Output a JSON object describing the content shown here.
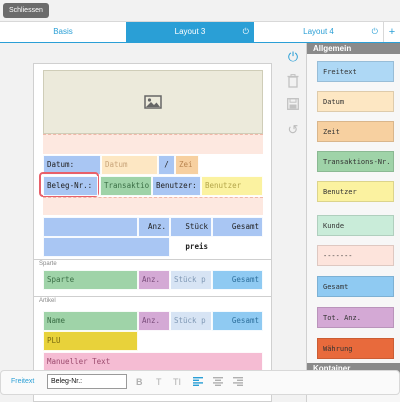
{
  "topbar": {
    "close_label": "Schliessen"
  },
  "tabs": [
    {
      "label": "Basis"
    },
    {
      "label": "Layout 3"
    },
    {
      "label": "Layout 4"
    }
  ],
  "tab_power_icon": "⏻",
  "add_tab_icon": "+",
  "canvas": {
    "image_icon": "image-icon",
    "header_rows": {
      "datum_label": "Datum:",
      "datum_value": "Datum",
      "slash": "/",
      "zeit_value": "Zei",
      "beleg_label": "Beleg-Nr.:",
      "transaktion_value": "Transaktio",
      "benutzer_label": "Benutzer:",
      "benutzer_value": "Benutzer"
    },
    "column_headers": {
      "anz": "Anz.",
      "stueck": "Stück",
      "gesamt": "Gesamt",
      "preis": "preis"
    },
    "sparte_section": {
      "title": "Sparte",
      "cells": [
        "Sparte",
        "Anz.",
        "Stück p",
        "Gesamt"
      ]
    },
    "artikel_section": {
      "title": "Artikel",
      "name_row": [
        "Name",
        "Anz.",
        "Stück p",
        "Gesamt"
      ],
      "plu": "PLU",
      "manueller_text": "Manueller Text"
    }
  },
  "tools": {
    "power": "⏻",
    "delete": "🗑",
    "save": "💾",
    "undo": "↺"
  },
  "palette": {
    "allgemein_header": "Allgemein",
    "kontainer_header": "Kontainer",
    "items": [
      {
        "label": "Freitext",
        "color": "#aed8f5"
      },
      {
        "label": "Datum",
        "color": "#fde7c3"
      },
      {
        "label": "Zeit",
        "color": "#f7d0a0"
      },
      {
        "label": "Transaktions-Nr.",
        "color": "#9fd3a8"
      },
      {
        "label": "Benutzer",
        "color": "#fbf2a0"
      },
      {
        "label": "Kunde",
        "color": "#c9ecd9"
      },
      {
        "label": "-------",
        "color": "#fde4dc"
      },
      {
        "label": "Gesamt",
        "color": "#8fcaf2"
      },
      {
        "label": "Tot. Anz.",
        "color": "#d4a9d5"
      },
      {
        "label": "Währung",
        "color": "#e86a3c"
      }
    ]
  },
  "bottombar": {
    "label": "Freitext",
    "input_value": "Beleg-Nr.:",
    "buttons": [
      "B",
      "T",
      "TI"
    ]
  }
}
